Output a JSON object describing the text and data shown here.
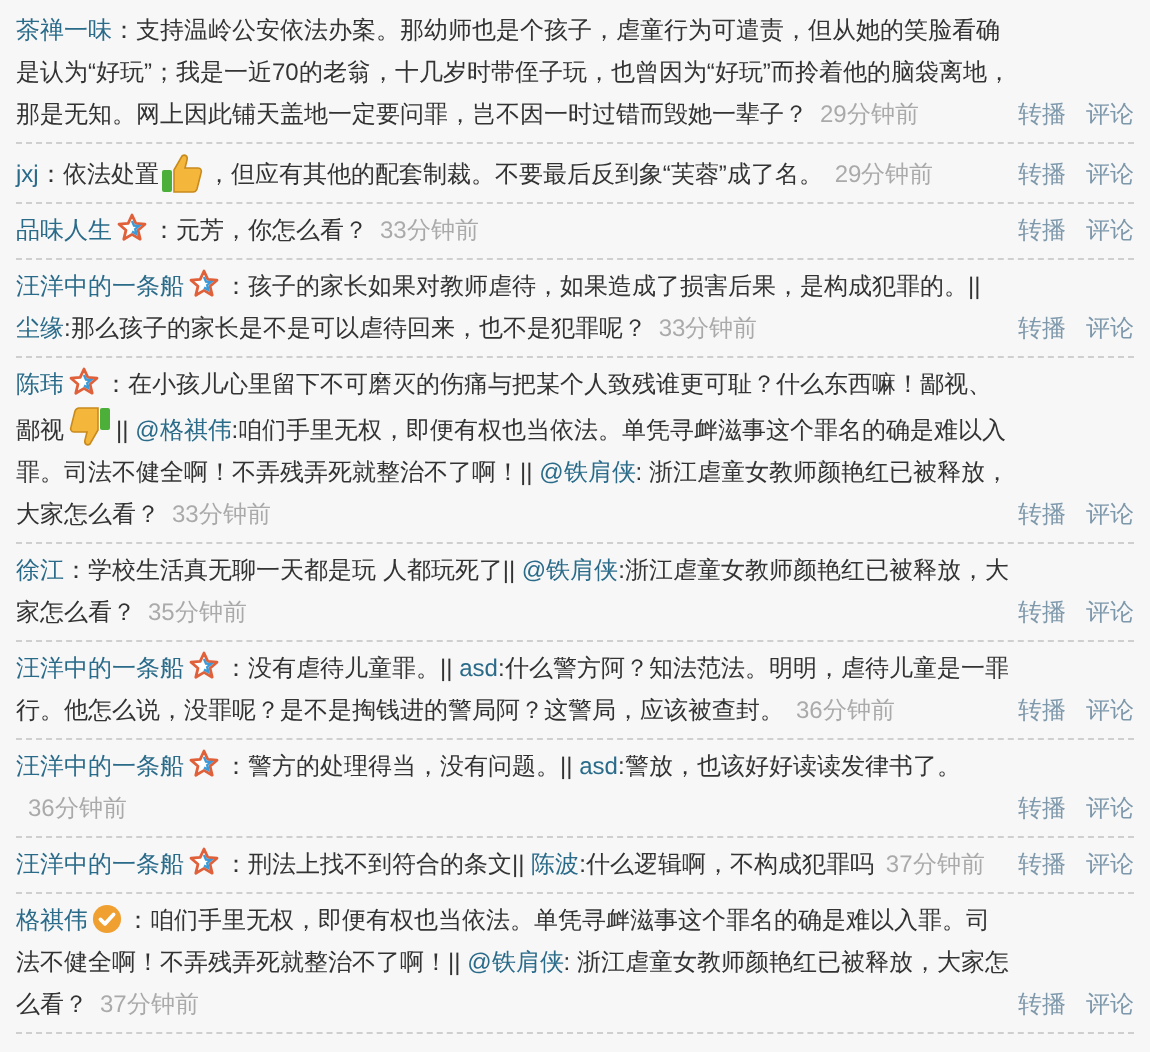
{
  "comments": [
    {
      "author": "茶禅一味",
      "star": false,
      "verified": false,
      "body": [
        {
          "kind": "text",
          "text": "：支持温岭公安依法办案。那幼师也是个孩子，虐童行为可遣责，但从她的笑脸看确是认为“好玩”；我是一近70的老翁，十几岁时带侄子玩，也曾因为“好玩”而拎着他的脑袋离地，那是无知。网上因此铺天盖地一定要问罪，岂不因一时过错而毁她一辈子？"
        }
      ],
      "time": "29分钟前",
      "actions": [
        "转播",
        "评论"
      ]
    },
    {
      "author": "jxj",
      "star": false,
      "verified": false,
      "body": [
        {
          "kind": "text",
          "text": "：依法处置"
        },
        {
          "kind": "thumbsup"
        },
        {
          "kind": "text",
          "text": "，但应有其他的配套制裁。不要最后反到象“芙蓉”成了名。"
        }
      ],
      "time": "29分钟前",
      "actions": [
        "转播",
        "评论"
      ]
    },
    {
      "author": "品味人生",
      "star": true,
      "verified": false,
      "body": [
        {
          "kind": "text",
          "text": "：元芳，你怎么看？"
        }
      ],
      "time": "33分钟前",
      "actions": [
        "转播",
        "评论"
      ]
    },
    {
      "author": "汪洋中的一条船",
      "star": true,
      "verified": false,
      "body": [
        {
          "kind": "text",
          "text": "：孩子的家长如果对教师虐待，如果造成了损害后果，是构成犯罪的。||"
        },
        {
          "kind": "mention",
          "text": "尘缘"
        },
        {
          "kind": "text",
          "text": ":那么孩子的家长是不是可以虐待回来，也不是犯罪呢？"
        }
      ],
      "time": "33分钟前",
      "actions": [
        "转播",
        "评论"
      ]
    },
    {
      "author": "陈玮",
      "star": true,
      "verified": false,
      "body": [
        {
          "kind": "text",
          "text": "：在小孩儿心里留下不可磨灭的伤痛与把某个人致残谁更可耻？什么东西嘛！鄙视、鄙视"
        },
        {
          "kind": "thumbsdown"
        },
        {
          "kind": "text",
          "text": "|| "
        },
        {
          "kind": "mention",
          "text": "@格祺伟"
        },
        {
          "kind": "text",
          "text": ":咱们手里无权，即便有权也当依法。单凭寻衅滋事这个罪名的确是难以入罪。司法不健全啊！不弄残弄死就整治不了啊！|| "
        },
        {
          "kind": "mention",
          "text": "@铁肩侠"
        },
        {
          "kind": "text",
          "text": ": 浙江虐童女教师颜艳红已被释放，大家怎么看？"
        }
      ],
      "time": "33分钟前",
      "actions": [
        "转播",
        "评论"
      ]
    },
    {
      "author": "徐江",
      "star": false,
      "verified": false,
      "body": [
        {
          "kind": "text",
          "text": "：学校生活真无聊一天都是玩 人都玩死了|| "
        },
        {
          "kind": "mention",
          "text": "@铁肩侠"
        },
        {
          "kind": "text",
          "text": ":浙江虐童女教师颜艳红已被释放，大家怎么看？"
        }
      ],
      "time": "35分钟前",
      "actions": [
        "转播",
        "评论"
      ]
    },
    {
      "author": "汪洋中的一条船",
      "star": true,
      "verified": false,
      "body": [
        {
          "kind": "text",
          "text": "：没有虐待儿童罪。|| "
        },
        {
          "kind": "mention",
          "text": "asd"
        },
        {
          "kind": "text",
          "text": ":什么警方阿？知法范法。明明，虐待儿童是一罪行。他怎么说，没罪呢？是不是掏钱进的警局阿？这警局，应该被查封。"
        }
      ],
      "time": "36分钟前",
      "actions": [
        "转播",
        "评论"
      ]
    },
    {
      "author": "汪洋中的一条船",
      "star": true,
      "verified": false,
      "body": [
        {
          "kind": "text",
          "text": "：警方的处理得当，没有问题。|| "
        },
        {
          "kind": "mention",
          "text": "asd"
        },
        {
          "kind": "text",
          "text": ":警放，也该好好读读发律书了。"
        }
      ],
      "time": "36分钟前",
      "actions": [
        "转播",
        "评论"
      ]
    },
    {
      "author": "汪洋中的一条船",
      "star": true,
      "verified": false,
      "body": [
        {
          "kind": "text",
          "text": "：刑法上找不到符合的条文|| "
        },
        {
          "kind": "mention",
          "text": "陈波"
        },
        {
          "kind": "text",
          "text": ":什么逻辑啊，不构成犯罪吗"
        }
      ],
      "time": "37分钟前",
      "actions": [
        "转播",
        "评论"
      ]
    },
    {
      "author": "格祺伟",
      "star": false,
      "verified": true,
      "body": [
        {
          "kind": "text",
          "text": "：咱们手里无权，即便有权也当依法。单凭寻衅滋事这个罪名的确是难以入罪。司法不健全啊！不弄残弄死就整治不了啊！|| "
        },
        {
          "kind": "mention",
          "text": "@铁肩侠"
        },
        {
          "kind": "text",
          "text": ": 浙江虐童女教师颜艳红已被释放，大家怎么看？"
        }
      ],
      "time": "37分钟前",
      "actions": [
        "转播",
        "评论"
      ]
    }
  ]
}
